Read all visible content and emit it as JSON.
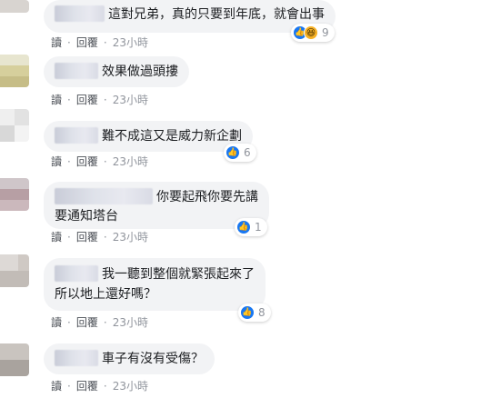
{
  "comments": [
    {
      "text": "這對兄弟，真的只要到年底，就會出事",
      "reply_label": "回覆",
      "read_label": "讀",
      "time": "23小時",
      "reactions": {
        "count": "9",
        "icons": [
          "like-icon",
          "haha-icon"
        ]
      }
    },
    {
      "text": "效果做過頭摟",
      "reply_label": "回覆",
      "read_label": "讀",
      "time": "23小時"
    },
    {
      "text": "難不成這又是威力新企劃",
      "reply_label": "回覆",
      "read_label": "讀",
      "time": "23小時",
      "reactions": {
        "count": "6",
        "icons": [
          "like-icon"
        ]
      }
    },
    {
      "text": "你要起飛你要先講",
      "text2": "要通知塔台",
      "reply_label": "回覆",
      "read_label": "讀",
      "time": "23小時",
      "reactions": {
        "count": "1",
        "icons": [
          "like-icon"
        ]
      }
    },
    {
      "text": "我一聽到整個就緊張起來了",
      "text2": "所以地上還好嗎？",
      "reply_label": "回覆",
      "read_label": "讀",
      "time": "23小時",
      "reactions": {
        "count": "8",
        "icons": [
          "like-icon"
        ]
      }
    },
    {
      "text": "車子有沒有受傷？",
      "reply_label": "回覆",
      "read_label": "讀",
      "time": "23小時"
    }
  ],
  "colors": {
    "like": "#1877f2",
    "haha": "#f7b125",
    "bubble": "#f2f3f5",
    "meta": "#90949c"
  }
}
